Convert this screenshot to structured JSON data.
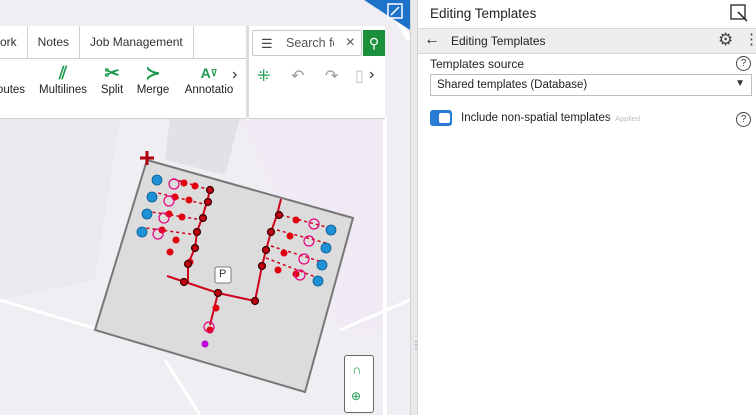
{
  "ribbon": {
    "tabs": [
      "ork",
      "Notes",
      "Job Management"
    ],
    "tools": [
      {
        "label": "outes",
        "icon": "routes-icon"
      },
      {
        "label": "Multilines",
        "icon": "multilines-icon"
      },
      {
        "label": "Split",
        "icon": "scissors-icon"
      },
      {
        "label": "Merge",
        "icon": "merge-icon"
      },
      {
        "label": "Annotatio",
        "icon": "annotation-icon"
      }
    ]
  },
  "search": {
    "placeholder": "Search fo"
  },
  "panel": {
    "title": "Editing Templates",
    "subheader": "Editing Templates",
    "templates_source_label": "Templates source",
    "templates_source_value": "Shared templates (Database)",
    "toggle_label": "Include non-spatial templates",
    "toggle_on": true,
    "applied_text": "Applied"
  },
  "map": {
    "marker_label": "P",
    "colors": {
      "accent": "#2a7bd4",
      "line": "#d0021b",
      "tool_green": "#1a9a4a",
      "device": "#e6007e"
    }
  }
}
